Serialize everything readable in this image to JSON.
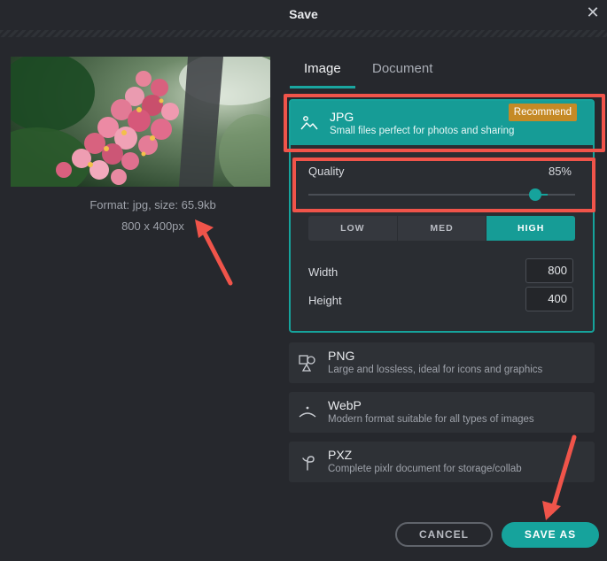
{
  "dialog": {
    "title": "Save",
    "close_glyph": "✕"
  },
  "preview": {
    "format_line": "Format: jpg, size: 65.9kb",
    "dimensions_line": "800 x 400px"
  },
  "tabs": [
    {
      "label": "Image",
      "active": true
    },
    {
      "label": "Document",
      "active": false
    }
  ],
  "formats": {
    "jpg": {
      "title": "JPG",
      "description": "Small files perfect for photos and sharing",
      "badge": "Recommend",
      "icon": "mountains-icon"
    },
    "png": {
      "title": "PNG",
      "description": "Large and lossless, ideal for icons and graphics",
      "icon": "shapes-icon"
    },
    "webp": {
      "title": "WebP",
      "description": "Modern format suitable for all types of images",
      "icon": "arc-icon"
    },
    "pxz": {
      "title": "PXZ",
      "description": "Complete pixlr document for storage/collab",
      "icon": "pixlr-icon"
    }
  },
  "quality": {
    "label": "Quality",
    "value_text": "85%",
    "value": 0.85,
    "presets": [
      {
        "label": "LOW",
        "active": false
      },
      {
        "label": "MED",
        "active": false
      },
      {
        "label": "HIGH",
        "active": true
      }
    ]
  },
  "size": {
    "width_label": "Width",
    "width_value": "800",
    "height_label": "Height",
    "height_value": "400"
  },
  "buttons": {
    "cancel": "CANCEL",
    "save_as": "SAVE AS"
  },
  "colors": {
    "accent": "#16a39c",
    "badge": "#c58a26",
    "annotation": "#f0544a",
    "background": "#26282d"
  }
}
